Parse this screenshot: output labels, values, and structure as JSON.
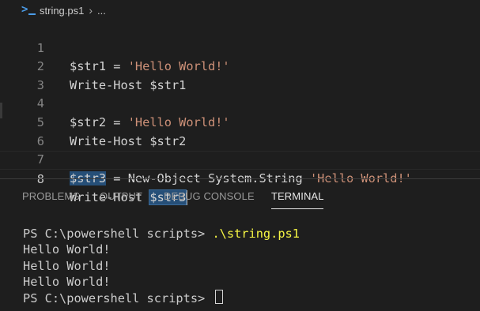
{
  "breadcrumb": {
    "file": "string.ps1",
    "sep": "›",
    "more": "..."
  },
  "editor": {
    "lines": [
      {
        "n": "1",
        "text": "$str1 = 'Hello World!'"
      },
      {
        "n": "2",
        "text": "Write-Host $str1"
      },
      {
        "n": "3",
        "text": ""
      },
      {
        "n": "4",
        "text": "$str2 = 'Hello World!'"
      },
      {
        "n": "5",
        "text": "Write-Host $str2"
      },
      {
        "n": "6",
        "text": ""
      },
      {
        "n": "7",
        "text": "$str3 = New-Object System.String 'Hello World!'"
      },
      {
        "n": "8",
        "text": "Write-Host $str3"
      }
    ],
    "tokens": {
      "l1_var": "$str1",
      "l1_eq": " = ",
      "l1_str": "'Hello World!'",
      "l2_cmd": "Write-Host ",
      "l2_var": "$str1",
      "l4_var": "$str2",
      "l4_eq": " = ",
      "l4_str": "'Hello World!'",
      "l5_cmd": "Write-Host ",
      "l5_var": "$str2",
      "l7_var": "$str3",
      "l7_mid": " = New-Object System.String ",
      "l7_str": "'Hello World!'",
      "l8_cmd": "Write-Host ",
      "l8_var": "$str3"
    }
  },
  "panel": {
    "tabs": [
      "PROBLEMS",
      "OUTPUT",
      "DEBUG CONSOLE",
      "TERMINAL"
    ],
    "active_tab": "TERMINAL"
  },
  "terminal": {
    "prompt1": "PS C:\\powershell scripts> ",
    "command": ".\\string.ps1",
    "output": [
      "Hello World!",
      "Hello World!",
      "Hello World!"
    ],
    "prompt2": "PS C:\\powershell scripts> "
  },
  "colors": {
    "background": "#1e1e1e",
    "string": "#ce9178",
    "selection": "#264f78",
    "terminal_command": "#f5f543"
  },
  "icons": {
    "file": "powershell-icon",
    "breadcrumb_sep": "chevron-right-icon"
  }
}
